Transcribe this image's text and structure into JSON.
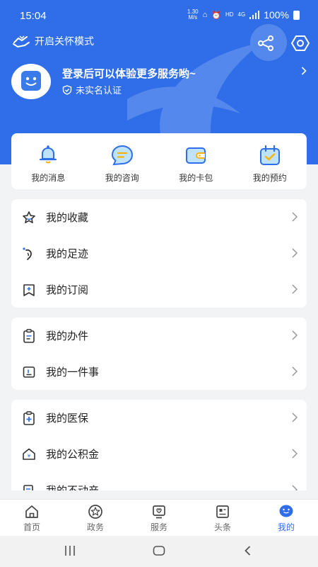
{
  "status_bar": {
    "time": "15:04",
    "net_speed_top": "1.30",
    "net_speed_bottom": "M/s",
    "hd": "HD",
    "network": "4G",
    "battery": "100%"
  },
  "header": {
    "care_mode_label": "开启关怀模式",
    "login_prompt": "登录后可以体验更多服务哟~",
    "verification_status": "未实名认证"
  },
  "quick_actions": [
    {
      "label": "我的消息",
      "icon": "bell-icon"
    },
    {
      "label": "我的咨询",
      "icon": "chat-bubble-icon"
    },
    {
      "label": "我的卡包",
      "icon": "wallet-icon"
    },
    {
      "label": "我的预约",
      "icon": "calendar-check-icon"
    }
  ],
  "group1": [
    {
      "label": "我的收藏",
      "icon": "star-icon"
    },
    {
      "label": "我的足迹",
      "icon": "footprint-icon"
    },
    {
      "label": "我的订阅",
      "icon": "subscribe-icon"
    }
  ],
  "group2": [
    {
      "label": "我的办件",
      "icon": "clipboard-icon"
    },
    {
      "label": "我的一件事",
      "icon": "one-thing-icon"
    }
  ],
  "group3": [
    {
      "label": "我的医保",
      "icon": "medical-insurance-icon"
    },
    {
      "label": "我的公积金",
      "icon": "housing-fund-icon"
    },
    {
      "label": "我的不动产",
      "icon": "real-estate-icon"
    }
  ],
  "tabs": [
    {
      "label": "首页",
      "icon": "home-icon",
      "active": false
    },
    {
      "label": "政务",
      "icon": "government-icon",
      "active": false
    },
    {
      "label": "服务",
      "icon": "service-icon",
      "active": false
    },
    {
      "label": "头条",
      "icon": "news-icon",
      "active": false
    },
    {
      "label": "我的",
      "icon": "profile-icon",
      "active": true
    }
  ],
  "colors": {
    "primary": "#2f6ee8",
    "background": "#f2f3f5",
    "card": "#ffffff"
  }
}
